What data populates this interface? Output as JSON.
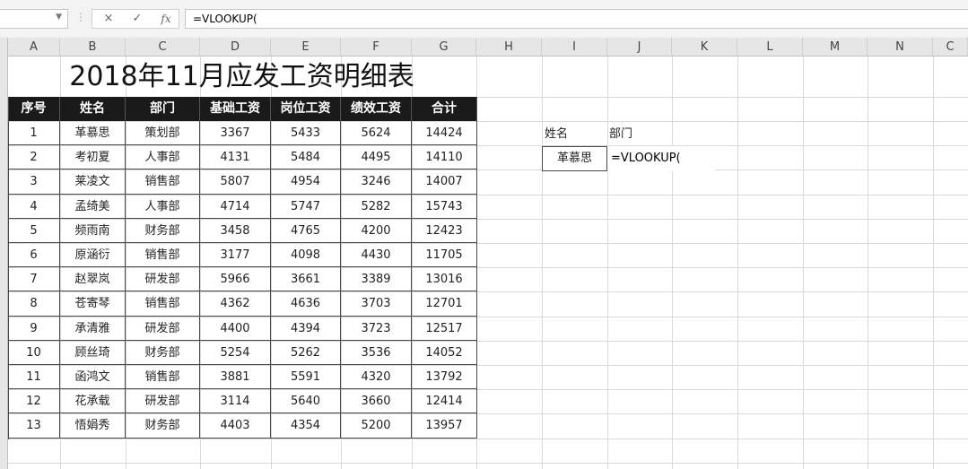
{
  "formula_bar": {
    "namebox_value": "",
    "cancel_icon": "×",
    "enter_icon": "✓",
    "fx_icon": "fx",
    "formula": "=VLOOKUP("
  },
  "columns": [
    "A",
    "B",
    "C",
    "D",
    "E",
    "F",
    "G",
    "H",
    "I",
    "J",
    "K",
    "L",
    "M",
    "N",
    "C"
  ],
  "sheet": {
    "title": "2018年11月应发工资明细表",
    "headers": [
      "序号",
      "姓名",
      "部门",
      "基础工资",
      "岗位工资",
      "绩效工资",
      "合计"
    ],
    "rows": [
      [
        "1",
        "革慕思",
        "策划部",
        "3367",
        "5433",
        "5624",
        "14424"
      ],
      [
        "2",
        "考初夏",
        "人事部",
        "4131",
        "5484",
        "4495",
        "14110"
      ],
      [
        "3",
        "莱凌文",
        "销售部",
        "5807",
        "4954",
        "3246",
        "14007"
      ],
      [
        "4",
        "孟绮美",
        "人事部",
        "4714",
        "5747",
        "5282",
        "15743"
      ],
      [
        "5",
        "频雨南",
        "财务部",
        "3458",
        "4765",
        "4200",
        "12423"
      ],
      [
        "6",
        "原涵衍",
        "销售部",
        "3177",
        "4098",
        "4430",
        "11705"
      ],
      [
        "7",
        "赵翠岚",
        "研发部",
        "5966",
        "3661",
        "3389",
        "13016"
      ],
      [
        "8",
        "苍寄琴",
        "销售部",
        "4362",
        "4636",
        "3703",
        "12701"
      ],
      [
        "9",
        "承清雅",
        "研发部",
        "4400",
        "4394",
        "3723",
        "12517"
      ],
      [
        "10",
        "顾丝琦",
        "财务部",
        "5254",
        "5262",
        "3536",
        "14052"
      ],
      [
        "11",
        "函鸿文",
        "销售部",
        "3881",
        "5591",
        "4320",
        "13792"
      ],
      [
        "12",
        "花承载",
        "研发部",
        "3114",
        "5640",
        "3660",
        "12414"
      ],
      [
        "13",
        "悟娟秀",
        "财务部",
        "4403",
        "4354",
        "5200",
        "13957"
      ]
    ]
  },
  "lookup": {
    "name_label": "姓名",
    "dept_label": "部门",
    "name_value": "革慕思",
    "formula": "=VLOOKUP("
  },
  "colors": {
    "header_bg": "#1a1a1a",
    "header_text": "#ffffff",
    "gridline": "#d9d9d9"
  }
}
